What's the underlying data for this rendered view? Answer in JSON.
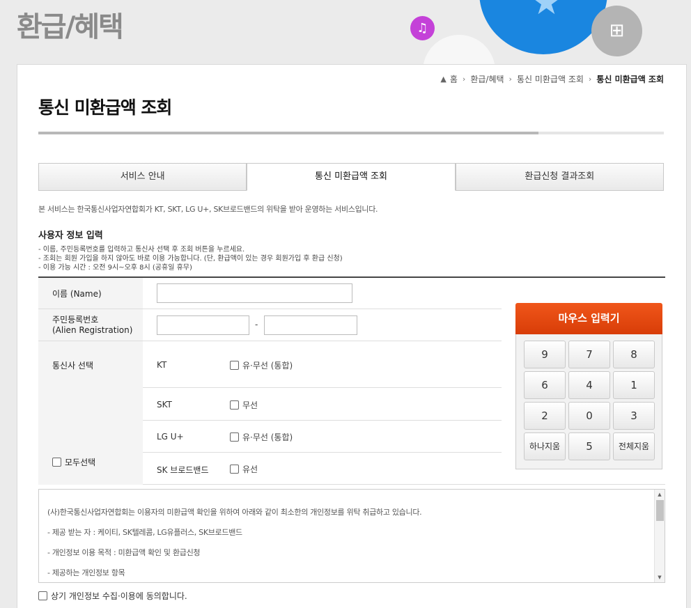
{
  "header": {
    "section_title": "환급/혜택",
    "music_icon": "♫",
    "gift_icon": "⊞",
    "star_icon": "★"
  },
  "breadcrumb": {
    "home": "홈",
    "level1": "환급/혜택",
    "level2": "통신 미환급액 조회",
    "current": "통신 미환급액 조회",
    "separator": "›"
  },
  "page": {
    "title": "통신 미환급액 조회",
    "progress": 0.8
  },
  "tabs": [
    {
      "label": "서비스 안내"
    },
    {
      "label": "통신 미환급액 조회"
    },
    {
      "label": "환급신청 결과조회"
    }
  ],
  "intro": "본 서비스는 한국통신사업자연합회가 KT, SKT, LG U+, SK브로드밴드의 위탁을 받아 운영하는 서비스입니다.",
  "user_section": {
    "title": "사용자 정보 입력",
    "notes": [
      "- 이름, 주민등록번호를 입력하고 통신사 선택 후 조회 버튼을 누르세요.",
      "- 조회는 회원 가입을 하지 않아도 바로 이용 가능합니다. (단, 환급액이 있는 경우 회원가입 후 환급 신청)",
      "- 이용 가능 시간 : 오전 9시~오후 8시 (공휴일 휴무)"
    ]
  },
  "form": {
    "name_label": "이름 (Name)",
    "reg_label": "주민등록번호",
    "reg_label_en": "(Alien Registration)",
    "reg_dash": "-",
    "carrier_label": "통신사 선택",
    "select_all": "모두선택",
    "carriers": [
      {
        "name": "KT",
        "option": "유·무선 (통합)"
      },
      {
        "name": "SKT",
        "option": "무선"
      },
      {
        "name": "LG U+",
        "option": "유·무선 (통합)"
      },
      {
        "name": "SK 브로드밴드",
        "option": "유선"
      }
    ]
  },
  "keypad": {
    "title": "마우스 입력기",
    "keys": [
      "9",
      "7",
      "8",
      "6",
      "4",
      "1",
      "2",
      "0",
      "3",
      "하나지움",
      "5",
      "전체지움"
    ]
  },
  "consent": {
    "lines": [
      "(사)한국통신사업자연합회는 이용자의 미환급액 확인을 위하여 아래와 같이 최소한의 개인정보를 위탁 취급하고 있습니다.",
      "- 제공 받는 자 : 케이티, SK텔레콤, LG유플러스, SK브로드밴드",
      "- 개인정보 이용 목적 : 미환급액 확인 및 환급신청",
      "- 제공하는 개인정보 항목"
    ],
    "scroll_up": "▲",
    "scroll_down": "▼",
    "agree_label": "상기 개인정보 수집·이용에 동의합니다."
  }
}
